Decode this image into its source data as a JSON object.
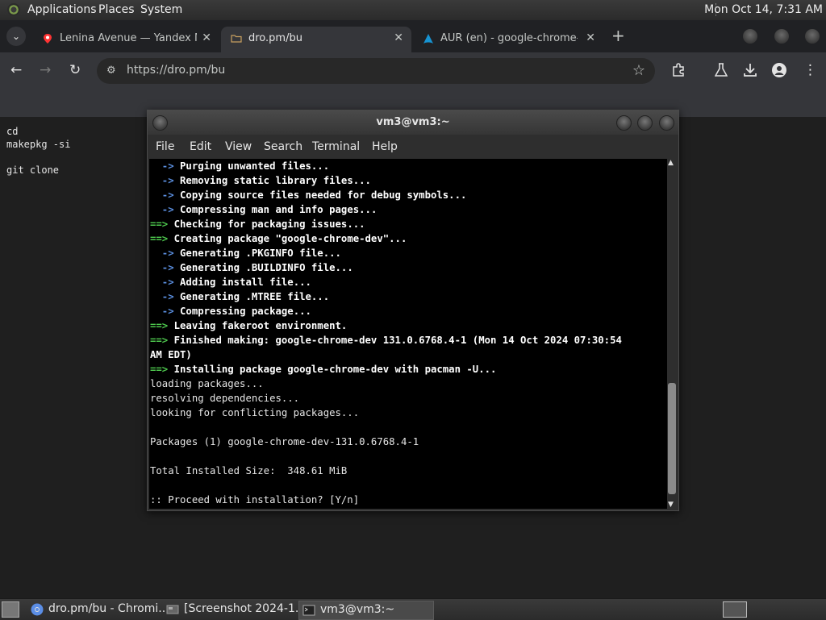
{
  "top_panel": {
    "menus": [
      "Applications",
      "Places",
      "System"
    ],
    "clock": "Mon Oct 14,  7:31 AM"
  },
  "browser": {
    "tabs": [
      {
        "title": "Lenina Avenue — Yandex Ma",
        "close": "✕",
        "favicon": "yandex-maps-icon"
      },
      {
        "title": "dro.pm/bu",
        "close": "✕",
        "favicon": "folder-icon"
      },
      {
        "title": "AUR (en) - google-chrome-d",
        "close": "✕",
        "favicon": "arch-linux-icon"
      }
    ],
    "active_tab": 1,
    "new_tab": "+",
    "url": "https://dro.pm/bu"
  },
  "page": {
    "lines": [
      "cd",
      "makepkg -si",
      "",
      "git clone"
    ]
  },
  "terminal": {
    "title": "vm3@vm3:~",
    "menu": [
      "File",
      "Edit",
      "View",
      "Search",
      "Terminal",
      "Help"
    ],
    "lines": [
      {
        "prefix": "  -> ",
        "text": "Purging unwanted files...",
        "style": "bold"
      },
      {
        "prefix": "  -> ",
        "text": "Removing static library files...",
        "style": "bold"
      },
      {
        "prefix": "  -> ",
        "text": "Copying source files needed for debug symbols...",
        "style": "bold"
      },
      {
        "prefix": "  -> ",
        "text": "Compressing man and info pages...",
        "style": "bold"
      },
      {
        "prefix": "==> ",
        "text": "Checking for packaging issues...",
        "style": "green"
      },
      {
        "prefix": "==> ",
        "text": "Creating package \"google-chrome-dev\"...",
        "style": "green"
      },
      {
        "prefix": "  -> ",
        "text": "Generating .PKGINFO file...",
        "style": "bold"
      },
      {
        "prefix": "  -> ",
        "text": "Generating .BUILDINFO file...",
        "style": "bold"
      },
      {
        "prefix": "  -> ",
        "text": "Adding install file...",
        "style": "bold"
      },
      {
        "prefix": "  -> ",
        "text": "Generating .MTREE file...",
        "style": "bold"
      },
      {
        "prefix": "  -> ",
        "text": "Compressing package...",
        "style": "bold"
      },
      {
        "prefix": "==> ",
        "text": "Leaving fakeroot environment.",
        "style": "green"
      },
      {
        "prefix": "==> ",
        "text": "Finished making: google-chrome-dev 131.0.6768.4-1 (Mon 14 Oct 2024 07:30:54",
        "style": "green"
      },
      {
        "prefix": "",
        "text": "AM EDT)",
        "style": "boldonly"
      },
      {
        "prefix": "==> ",
        "text": "Installing package google-chrome-dev with pacman -U...",
        "style": "green"
      },
      {
        "prefix": "",
        "text": "loading packages...",
        "style": "plain"
      },
      {
        "prefix": "",
        "text": "resolving dependencies...",
        "style": "plain"
      },
      {
        "prefix": "",
        "text": "looking for conflicting packages...",
        "style": "plain"
      },
      {
        "prefix": "",
        "text": "",
        "style": "plain"
      },
      {
        "prefix": "",
        "text": "Packages (1) google-chrome-dev-131.0.6768.4-1",
        "style": "plain"
      },
      {
        "prefix": "",
        "text": "",
        "style": "plain"
      },
      {
        "prefix": "",
        "text": "Total Installed Size:  348.61 MiB",
        "style": "plain"
      },
      {
        "prefix": "",
        "text": "",
        "style": "plain"
      },
      {
        "prefix": "",
        "text": ":: Proceed with installation? [Y/n] ",
        "style": "plain"
      }
    ]
  },
  "taskbar": {
    "tasks": [
      {
        "label": "dro.pm/bu - Chromi...",
        "icon": "chromium-icon"
      },
      {
        "label": "[Screenshot 2024-1...",
        "icon": "screenshot-icon"
      },
      {
        "label": "vm3@vm3:~",
        "icon": "terminal-icon"
      }
    ]
  },
  "colors": {
    "terminal_green": "#4ec94e",
    "chrome_dark": "#202124",
    "toolbar": "#35363a"
  }
}
